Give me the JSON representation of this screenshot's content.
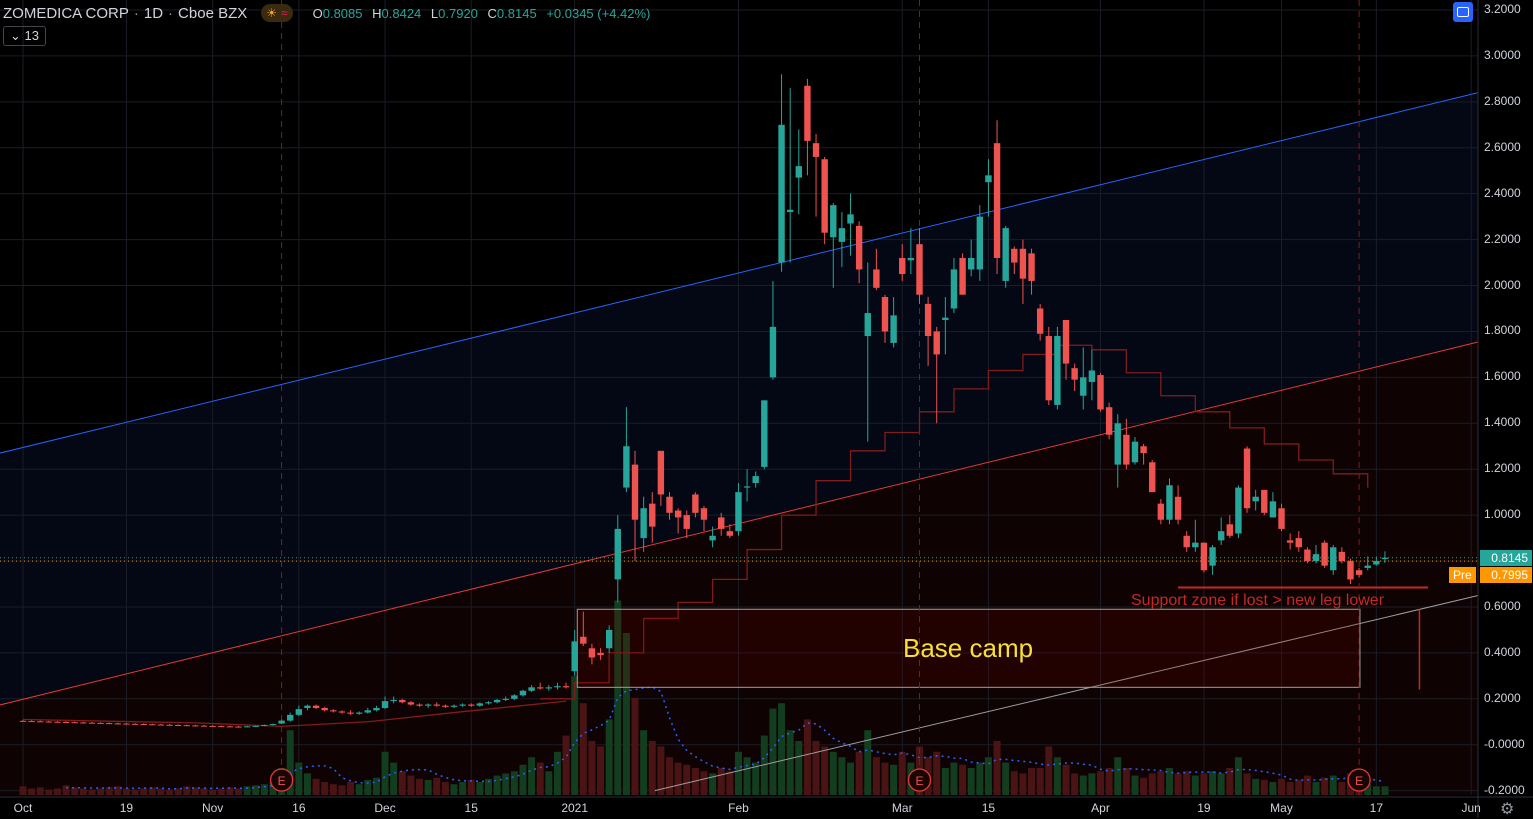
{
  "header": {
    "symbol": "ZOMEDICA CORP",
    "interval": "1D",
    "exchange": "Cboe BZX",
    "sep": "·",
    "sun_icon": "☀",
    "wave_icon": "≈",
    "ohlc": {
      "o_label": "O",
      "o": "0.8085",
      "h_label": "H",
      "h": "0.8424",
      "l_label": "L",
      "l": "0.7920",
      "c_label": "C",
      "c": "0.8145",
      "change": "+0.0345 (+4.42%)"
    },
    "indicator_toggle": "⌄ 13"
  },
  "price_tags": {
    "last": "0.8145",
    "pre_label": "Pre",
    "pre": "0.7995",
    "last_color": "#26a69a",
    "pre_color": "#ff9800"
  },
  "annotations": {
    "base_camp": "Base camp",
    "support": "Support zone if lost > new leg lower",
    "earnings_marker": "E"
  },
  "colors": {
    "up": "#26a69a",
    "down": "#ef5350",
    "blue_line": "#2962ff",
    "red_line": "#e53935",
    "annotation_yellow": "#f5e033"
  },
  "chart_data": {
    "type": "candlestick",
    "title": "ZOMEDICA CORP 1D Cboe BZX",
    "ylim": [
      -0.2,
      3.2
    ],
    "y_ticks": [
      "3.2000",
      "3.0000",
      "2.8000",
      "2.6000",
      "2.4000",
      "2.2000",
      "2.0000",
      "1.8000",
      "1.6000",
      "1.4000",
      "1.2000",
      "1.0000",
      "0.8000",
      "0.6000",
      "0.4000",
      "0.2000",
      "-0.0000",
      "-0.2000"
    ],
    "y_tick_values": [
      3.2,
      3.0,
      2.8,
      2.6,
      2.4,
      2.2,
      2.0,
      1.8,
      1.6,
      1.4,
      1.2,
      1.0,
      0.8,
      0.6,
      0.4,
      0.2,
      0,
      -0.2
    ],
    "x_ticks": [
      {
        "label": "Oct",
        "bar": 0
      },
      {
        "label": "19",
        "bar": 12
      },
      {
        "label": "Nov",
        "bar": 22
      },
      {
        "label": "16",
        "bar": 32
      },
      {
        "label": "Dec",
        "bar": 42
      },
      {
        "label": "15",
        "bar": 52
      },
      {
        "label": "2021",
        "bar": 64
      },
      {
        "label": "Feb",
        "bar": 83
      },
      {
        "label": "Mar",
        "bar": 102
      },
      {
        "label": "15",
        "bar": 112
      },
      {
        "label": "Apr",
        "bar": 125
      },
      {
        "label": "19",
        "bar": 137
      },
      {
        "label": "May",
        "bar": 146
      },
      {
        "label": "17",
        "bar": 157
      },
      {
        "label": "Jun",
        "bar": 168
      }
    ],
    "earnings_bars": [
      30,
      104,
      155
    ],
    "ohlc": [
      [
        0.104,
        0.108,
        0.101,
        0.103
      ],
      [
        0.103,
        0.106,
        0.1,
        0.102
      ],
      [
        0.102,
        0.105,
        0.099,
        0.101
      ],
      [
        0.101,
        0.104,
        0.098,
        0.1
      ],
      [
        0.1,
        0.103,
        0.097,
        0.099
      ],
      [
        0.099,
        0.102,
        0.096,
        0.098
      ],
      [
        0.098,
        0.101,
        0.095,
        0.097
      ],
      [
        0.097,
        0.1,
        0.094,
        0.096
      ],
      [
        0.096,
        0.099,
        0.093,
        0.095
      ],
      [
        0.095,
        0.098,
        0.092,
        0.094
      ],
      [
        0.094,
        0.097,
        0.091,
        0.093
      ],
      [
        0.093,
        0.096,
        0.09,
        0.092
      ],
      [
        0.092,
        0.095,
        0.089,
        0.091
      ],
      [
        0.091,
        0.094,
        0.088,
        0.09
      ],
      [
        0.09,
        0.093,
        0.087,
        0.089
      ],
      [
        0.089,
        0.092,
        0.086,
        0.088
      ],
      [
        0.088,
        0.091,
        0.085,
        0.087
      ],
      [
        0.087,
        0.09,
        0.084,
        0.086
      ],
      [
        0.086,
        0.089,
        0.083,
        0.085
      ],
      [
        0.085,
        0.088,
        0.082,
        0.084
      ],
      [
        0.084,
        0.087,
        0.081,
        0.083
      ],
      [
        0.083,
        0.086,
        0.08,
        0.082
      ],
      [
        0.082,
        0.085,
        0.079,
        0.081
      ],
      [
        0.081,
        0.084,
        0.078,
        0.08
      ],
      [
        0.08,
        0.083,
        0.077,
        0.079
      ],
      [
        0.079,
        0.082,
        0.076,
        0.078
      ],
      [
        0.078,
        0.082,
        0.076,
        0.08
      ],
      [
        0.08,
        0.084,
        0.078,
        0.082
      ],
      [
        0.082,
        0.088,
        0.08,
        0.086
      ],
      [
        0.086,
        0.092,
        0.084,
        0.09
      ],
      [
        0.092,
        0.11,
        0.09,
        0.105
      ],
      [
        0.105,
        0.14,
        0.1,
        0.13
      ],
      [
        0.13,
        0.17,
        0.125,
        0.155
      ],
      [
        0.16,
        0.175,
        0.15,
        0.17
      ],
      [
        0.17,
        0.175,
        0.155,
        0.16
      ],
      [
        0.16,
        0.165,
        0.145,
        0.15
      ],
      [
        0.15,
        0.155,
        0.14,
        0.145
      ],
      [
        0.145,
        0.15,
        0.135,
        0.14
      ],
      [
        0.14,
        0.15,
        0.13,
        0.135
      ],
      [
        0.135,
        0.145,
        0.13,
        0.14
      ],
      [
        0.14,
        0.16,
        0.135,
        0.15
      ],
      [
        0.15,
        0.17,
        0.145,
        0.16
      ],
      [
        0.16,
        0.21,
        0.155,
        0.19
      ],
      [
        0.19,
        0.21,
        0.18,
        0.195
      ],
      [
        0.195,
        0.2,
        0.18,
        0.185
      ],
      [
        0.185,
        0.19,
        0.17,
        0.175
      ],
      [
        0.175,
        0.18,
        0.165,
        0.17
      ],
      [
        0.17,
        0.18,
        0.16,
        0.175
      ],
      [
        0.175,
        0.185,
        0.165,
        0.17
      ],
      [
        0.17,
        0.175,
        0.16,
        0.165
      ],
      [
        0.165,
        0.175,
        0.16,
        0.17
      ],
      [
        0.17,
        0.18,
        0.165,
        0.175
      ],
      [
        0.175,
        0.18,
        0.165,
        0.17
      ],
      [
        0.17,
        0.185,
        0.165,
        0.18
      ],
      [
        0.18,
        0.19,
        0.175,
        0.185
      ],
      [
        0.185,
        0.2,
        0.18,
        0.195
      ],
      [
        0.195,
        0.21,
        0.19,
        0.2
      ],
      [
        0.2,
        0.22,
        0.195,
        0.215
      ],
      [
        0.215,
        0.24,
        0.21,
        0.235
      ],
      [
        0.235,
        0.26,
        0.23,
        0.25
      ],
      [
        0.25,
        0.27,
        0.24,
        0.245
      ],
      [
        0.245,
        0.26,
        0.235,
        0.25
      ],
      [
        0.25,
        0.27,
        0.24,
        0.255
      ],
      [
        0.255,
        0.27,
        0.245,
        0.25
      ],
      [
        0.32,
        0.5,
        0.3,
        0.45
      ],
      [
        0.47,
        0.58,
        0.43,
        0.44
      ],
      [
        0.42,
        0.44,
        0.35,
        0.38
      ],
      [
        0.4,
        0.42,
        0.37,
        0.39
      ],
      [
        0.42,
        0.52,
        0.4,
        0.5
      ],
      [
        0.72,
        1.0,
        0.62,
        0.94
      ],
      [
        1.12,
        1.47,
        1.1,
        1.3
      ],
      [
        1.22,
        1.28,
        0.8,
        0.98
      ],
      [
        0.9,
        1.08,
        0.84,
        1.03
      ],
      [
        1.05,
        1.1,
        0.88,
        0.95
      ],
      [
        1.28,
        1.28,
        1.04,
        1.09
      ],
      [
        1.08,
        1.1,
        0.98,
        1.01
      ],
      [
        1.02,
        1.03,
        0.92,
        0.99
      ],
      [
        1.0,
        1.02,
        0.9,
        0.94
      ],
      [
        1.09,
        1.1,
        0.99,
        1.01
      ],
      [
        1.03,
        1.04,
        0.93,
        0.98
      ],
      [
        0.89,
        0.95,
        0.86,
        0.91
      ],
      [
        0.99,
        1.01,
        0.91,
        0.94
      ],
      [
        0.93,
        0.96,
        0.9,
        0.91
      ],
      [
        0.93,
        1.14,
        0.91,
        1.1
      ],
      [
        1.12,
        1.2,
        1.06,
        1.125
      ],
      [
        1.14,
        1.19,
        1.12,
        1.17
      ],
      [
        1.21,
        1.5,
        1.2,
        1.5
      ],
      [
        1.6,
        2.02,
        1.59,
        1.82
      ],
      [
        2.1,
        2.92,
        2.06,
        2.7
      ],
      [
        2.32,
        2.86,
        2.1,
        2.33
      ],
      [
        2.47,
        2.68,
        2.31,
        2.52
      ],
      [
        2.87,
        2.9,
        2.48,
        2.63
      ],
      [
        2.62,
        2.66,
        2.3,
        2.56
      ],
      [
        2.55,
        2.56,
        2.18,
        2.23
      ],
      [
        2.21,
        2.36,
        1.99,
        2.35
      ],
      [
        2.19,
        2.32,
        2.08,
        2.25
      ],
      [
        2.27,
        2.4,
        2.13,
        2.31
      ],
      [
        2.26,
        2.28,
        2.01,
        2.07
      ],
      [
        1.78,
        2.1,
        1.32,
        1.88
      ],
      [
        2.07,
        2.16,
        1.98,
        1.99
      ],
      [
        1.95,
        1.96,
        1.75,
        1.8
      ],
      [
        1.75,
        1.95,
        1.73,
        1.87
      ],
      [
        2.12,
        2.18,
        2.02,
        2.05
      ],
      [
        2.11,
        2.25,
        2.05,
        2.12
      ],
      [
        2.18,
        2.25,
        1.92,
        1.96
      ],
      [
        1.92,
        1.95,
        1.65,
        1.78
      ],
      [
        1.8,
        1.82,
        1.4,
        1.7
      ],
      [
        1.85,
        1.95,
        1.7,
        1.86
      ],
      [
        1.9,
        2.12,
        1.88,
        2.07
      ],
      [
        2.12,
        2.14,
        1.96,
        1.96
      ],
      [
        2.07,
        2.2,
        2.04,
        2.12
      ],
      [
        2.07,
        2.35,
        2.02,
        2.3
      ],
      [
        2.45,
        2.55,
        2.3,
        2.48
      ],
      [
        2.62,
        2.72,
        2.05,
        2.12
      ],
      [
        2.02,
        2.26,
        1.99,
        2.25
      ],
      [
        2.16,
        2.17,
        2.05,
        2.1
      ],
      [
        2.16,
        2.2,
        1.92,
        2.03
      ],
      [
        2.14,
        2.16,
        1.96,
        2.02
      ],
      [
        1.9,
        1.92,
        1.76,
        1.79
      ],
      [
        1.78,
        1.82,
        1.48,
        1.5
      ],
      [
        1.48,
        1.82,
        1.46,
        1.78
      ],
      [
        1.85,
        1.85,
        1.59,
        1.66
      ],
      [
        1.64,
        1.66,
        1.54,
        1.59
      ],
      [
        1.52,
        1.73,
        1.46,
        1.6
      ],
      [
        1.58,
        1.72,
        1.5,
        1.63
      ],
      [
        1.61,
        1.62,
        1.45,
        1.46
      ],
      [
        1.47,
        1.49,
        1.33,
        1.35
      ],
      [
        1.22,
        1.44,
        1.12,
        1.4
      ],
      [
        1.35,
        1.42,
        1.2,
        1.22
      ],
      [
        1.23,
        1.34,
        1.22,
        1.32
      ],
      [
        1.3,
        1.31,
        1.22,
        1.27
      ],
      [
        1.23,
        1.24,
        1.1,
        1.1
      ],
      [
        1.05,
        1.07,
        0.96,
        0.98
      ],
      [
        0.98,
        1.16,
        0.96,
        1.13
      ],
      [
        1.08,
        1.13,
        0.96,
        0.98
      ],
      [
        0.91,
        0.93,
        0.84,
        0.86
      ],
      [
        0.86,
        0.98,
        0.84,
        0.88
      ],
      [
        0.88,
        0.88,
        0.75,
        0.76
      ],
      [
        0.78,
        0.87,
        0.74,
        0.86
      ],
      [
        0.89,
        0.99,
        0.87,
        0.93
      ],
      [
        0.96,
        1.0,
        0.9,
        0.91
      ],
      [
        0.92,
        1.13,
        0.9,
        1.12
      ],
      [
        1.29,
        1.3,
        1.01,
        1.03
      ],
      [
        1.06,
        1.11,
        1.02,
        1.08
      ],
      [
        1.11,
        1.11,
        1.0,
        1.01
      ],
      [
        0.99,
        1.1,
        0.99,
        1.06
      ],
      [
        1.03,
        1.05,
        0.93,
        0.94
      ],
      [
        0.89,
        0.92,
        0.85,
        0.88
      ],
      [
        0.9,
        0.93,
        0.84,
        0.86
      ],
      [
        0.85,
        0.86,
        0.79,
        0.8
      ],
      [
        0.8,
        0.87,
        0.79,
        0.83
      ],
      [
        0.88,
        0.89,
        0.77,
        0.78
      ],
      [
        0.76,
        0.87,
        0.74,
        0.86
      ],
      [
        0.84,
        0.86,
        0.79,
        0.8
      ],
      [
        0.8,
        0.81,
        0.7,
        0.72
      ],
      [
        0.76,
        0.77,
        0.73,
        0.74
      ],
      [
        0.77,
        0.82,
        0.76,
        0.78
      ],
      [
        0.785,
        0.82,
        0.78,
        0.8
      ],
      [
        0.8085,
        0.8424,
        0.792,
        0.8145
      ]
    ],
    "volume_relative": [
      8,
      6,
      7,
      5,
      6,
      9,
      7,
      6,
      5,
      6,
      7,
      8,
      6,
      5,
      6,
      7,
      6,
      5,
      6,
      8,
      7,
      6,
      5,
      6,
      7,
      6,
      8,
      9,
      10,
      12,
      25,
      60,
      30,
      20,
      15,
      12,
      10,
      9,
      12,
      10,
      14,
      16,
      40,
      30,
      22,
      18,
      15,
      14,
      16,
      12,
      10,
      12,
      14,
      12,
      15,
      18,
      20,
      22,
      28,
      35,
      30,
      22,
      40,
      55,
      110,
      85,
      50,
      45,
      70,
      180,
      150,
      90,
      60,
      50,
      45,
      35,
      30,
      28,
      25,
      22,
      20,
      25,
      22,
      40,
      35,
      30,
      55,
      80,
      85,
      60,
      50,
      70,
      50,
      45,
      40,
      35,
      30,
      40,
      60,
      35,
      30,
      28,
      40,
      30,
      45,
      35,
      40,
      25,
      30,
      28,
      25,
      30,
      35,
      50,
      30,
      22,
      20,
      25,
      25,
      45,
      35,
      28,
      20,
      18,
      20,
      22,
      25,
      35,
      25,
      18,
      16,
      20,
      22,
      25,
      20,
      22,
      18,
      20,
      22,
      20,
      25,
      35,
      20,
      15,
      14,
      12,
      15,
      12,
      14,
      18,
      12,
      16,
      18,
      12,
      20,
      15,
      10,
      8,
      8
    ],
    "moving_average_step": [
      [
        60,
        0.2
      ],
      [
        64,
        0.27
      ],
      [
        68,
        0.4
      ],
      [
        72,
        0.55
      ],
      [
        76,
        0.62
      ],
      [
        80,
        0.72
      ],
      [
        84,
        0.85
      ],
      [
        88,
        1.0
      ],
      [
        92,
        1.15
      ],
      [
        96,
        1.28
      ],
      [
        100,
        1.36
      ],
      [
        104,
        1.45
      ],
      [
        108,
        1.55
      ],
      [
        112,
        1.63
      ],
      [
        116,
        1.7
      ],
      [
        120,
        1.74
      ],
      [
        124,
        1.72
      ],
      [
        128,
        1.62
      ],
      [
        132,
        1.52
      ],
      [
        136,
        1.45
      ],
      [
        140,
        1.38
      ],
      [
        144,
        1.31
      ],
      [
        148,
        1.24
      ],
      [
        152,
        1.18
      ],
      [
        156,
        1.12
      ]
    ],
    "moving_average_left": [
      [
        0,
        0.11
      ],
      [
        20,
        0.095
      ],
      [
        30,
        0.08
      ],
      [
        40,
        0.1
      ],
      [
        50,
        0.14
      ],
      [
        63,
        0.19
      ]
    ],
    "trendlines": {
      "blue_upper": [
        [
          -2.7,
          1.27
        ],
        [
          168.8,
          2.84
        ]
      ],
      "red_middle": [
        [
          -2.7,
          0.173
        ],
        [
          168.8,
          1.754
        ]
      ],
      "gray_lower": [
        [
          73.3,
          -0.2
        ],
        [
          168.8,
          0.65
        ]
      ]
    },
    "base_camp_box": {
      "bar_from": 64.3,
      "bar_to": 155.1,
      "price_top": 0.59,
      "price_bottom": 0.25
    },
    "support_line": {
      "bar_from": 134,
      "bar_to": 163,
      "price": 0.685
    },
    "red_arrow": {
      "bar": 162,
      "price_top": 0.59,
      "price_bottom": 0.24
    },
    "last_price": 0.8145,
    "pre_price": 0.7995
  }
}
